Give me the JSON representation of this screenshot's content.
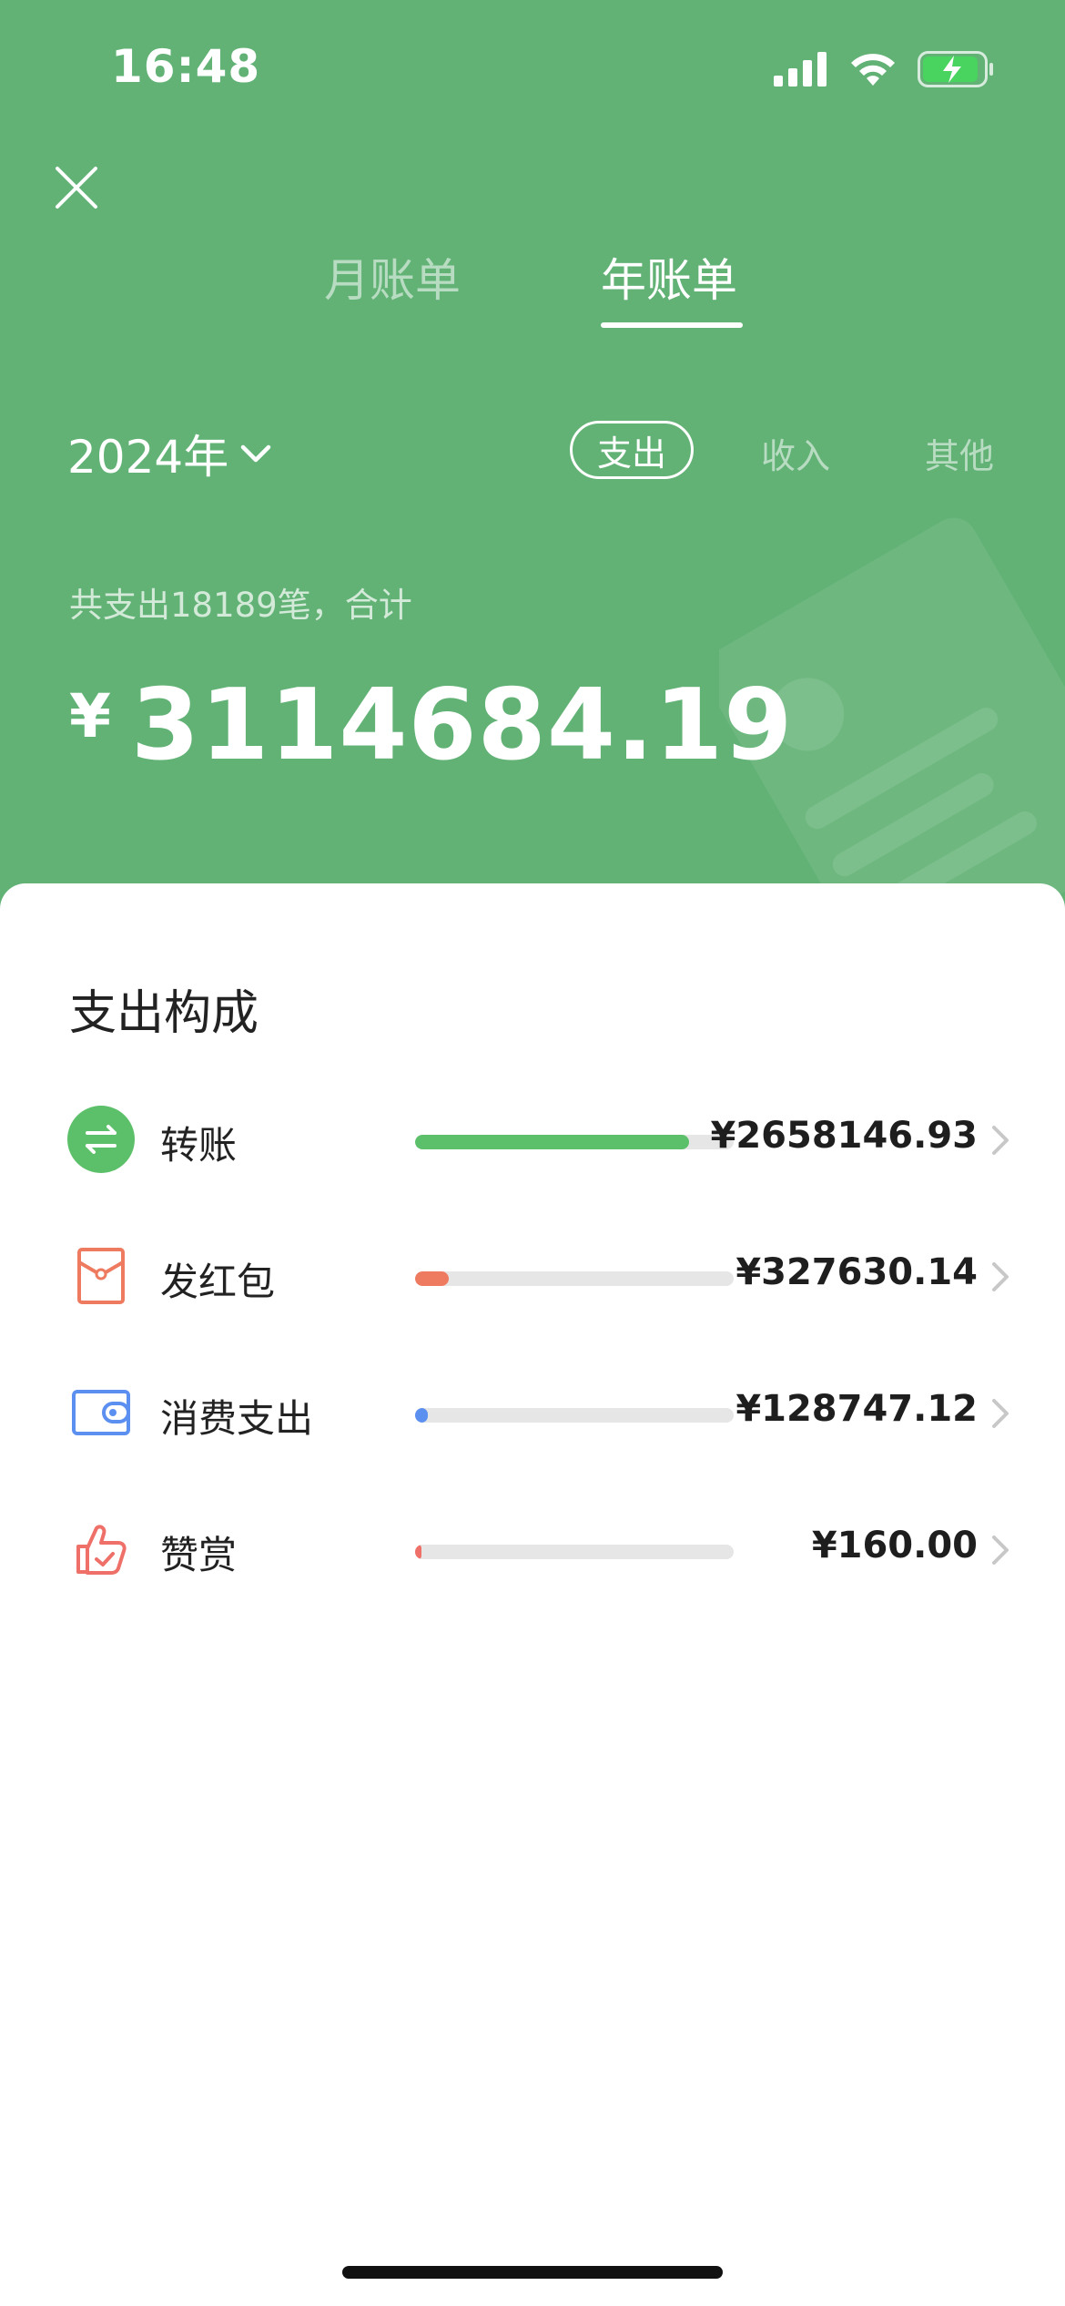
{
  "status": {
    "time": "16:48"
  },
  "tabs": {
    "month": "月账单",
    "year": "年账单"
  },
  "year_selector": {
    "value": "2024年"
  },
  "filters": {
    "expense": "支出",
    "income": "收入",
    "other": "其他"
  },
  "summary": {
    "text": "共支出18189笔，合计",
    "currency": "¥",
    "amount": "3114684.19"
  },
  "composition": {
    "title": "支出构成",
    "items": [
      {
        "label": "转账",
        "amount": "¥2658146.93",
        "share": 0.86,
        "color": "#5cc06a",
        "icon": "transfer-icon"
      },
      {
        "label": "发红包",
        "amount": "¥327630.14",
        "share": 0.105,
        "color": "#ee7a5f",
        "icon": "red-packet-icon"
      },
      {
        "label": "消费支出",
        "amount": "¥128747.12",
        "share": 0.04,
        "color": "#5b8ff0",
        "icon": "wallet-icon"
      },
      {
        "label": "赞赏",
        "amount": "¥160.00",
        "share": 0.02,
        "color": "#ee7068",
        "icon": "thumbs-up-icon"
      }
    ]
  },
  "colors": {
    "header_green": "#62b276",
    "text_dark": "#222222"
  }
}
